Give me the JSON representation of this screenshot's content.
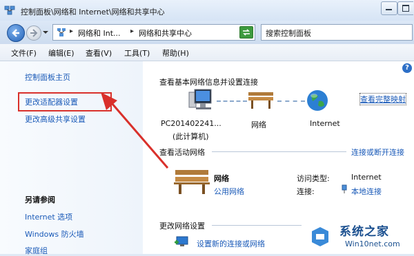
{
  "window": {
    "title": "控制面板\\网络和 Internet\\网络和共享中心"
  },
  "navbar": {
    "address_crumbs": [
      "网络和 Int...",
      "网络和共享中心"
    ],
    "search_placeholder": "搜索控制面板"
  },
  "menu": [
    "文件(F)",
    "编辑(E)",
    "查看(V)",
    "工具(T)",
    "帮助(H)"
  ],
  "sidebar": {
    "home": "控制面板主页",
    "adapter": "更改适配器设置",
    "advanced": "更改高级共享设置",
    "see_also_title": "另请参阅",
    "see_also": [
      "Internet 选项",
      "Windows 防火墙",
      "家庭组"
    ]
  },
  "main": {
    "basic_info_title": "查看基本网络信息并设置连接",
    "full_map_link": "查看完整映射",
    "map_nodes": [
      {
        "label": "PC201402241...",
        "sub": "(此计算机)"
      },
      {
        "label": "网络",
        "sub": ""
      },
      {
        "label": "Internet",
        "sub": ""
      }
    ],
    "active_networks_title": "查看活动网络",
    "connect_disconnect_link": "连接或断开连接",
    "network_name": "网络",
    "network_type": "公用网络",
    "access_type_label": "访问类型:",
    "access_type_value": "Internet",
    "connections_label": "连接:",
    "connections_value": "本地连接",
    "change_settings_title": "更改网络设置",
    "setup_connection": "设置新的连接或网络"
  },
  "watermark": {
    "brand": "系统之家",
    "site": "Win10net.com"
  },
  "colors": {
    "link": "#1a5ab8",
    "annotation_red": "#d9302b"
  }
}
